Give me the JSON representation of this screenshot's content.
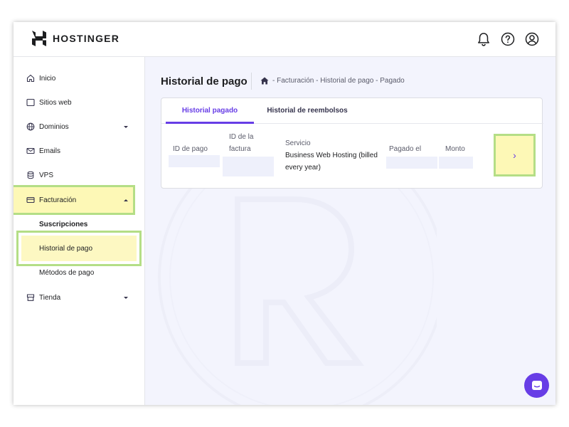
{
  "brand": {
    "name": "HOSTINGER"
  },
  "header": {
    "icons": [
      "bell-icon",
      "help-icon",
      "account-icon"
    ]
  },
  "sidebar": {
    "items": [
      {
        "label": "Inicio",
        "icon": "home-icon"
      },
      {
        "label": "Sitios web",
        "icon": "browser-icon"
      },
      {
        "label": "Dominios",
        "icon": "globe-icon",
        "expandable": true
      },
      {
        "label": "Emails",
        "icon": "mail-icon"
      },
      {
        "label": "VPS",
        "icon": "database-icon"
      },
      {
        "label": "Facturación",
        "icon": "credit-card-icon",
        "expanded": true
      },
      {
        "label": "Tienda",
        "icon": "store-icon",
        "expandable": true
      }
    ],
    "sub_items": [
      {
        "label": "Suscripciones"
      },
      {
        "label": "Historial de pago",
        "selected": true
      },
      {
        "label": "Métodos de pago"
      }
    ]
  },
  "main": {
    "page_title": "Historial de pago",
    "breadcrumb": [
      "Facturación",
      "Historial de pago",
      "Pagado"
    ],
    "breadcrumb_separator": "-",
    "tabs": [
      {
        "label": "Historial pagado",
        "active": true
      },
      {
        "label": "Historial de reembolsos",
        "active": false
      }
    ],
    "columns": {
      "payment_id": "ID de pago",
      "invoice_id_line1": "ID de la",
      "invoice_id_line2": "factura",
      "service": "Servicio",
      "paid_on": "Pagado el",
      "amount": "Monto"
    },
    "rows": [
      {
        "service_line1": "Business Web Hosting (billed",
        "service_line2": "every year)",
        "arrow": "›"
      }
    ]
  },
  "colors": {
    "accent": "#673de6",
    "highlight_fill": "#fdf8b6",
    "highlight_border": "#b4de86",
    "main_bg": "#f3f4fd"
  }
}
